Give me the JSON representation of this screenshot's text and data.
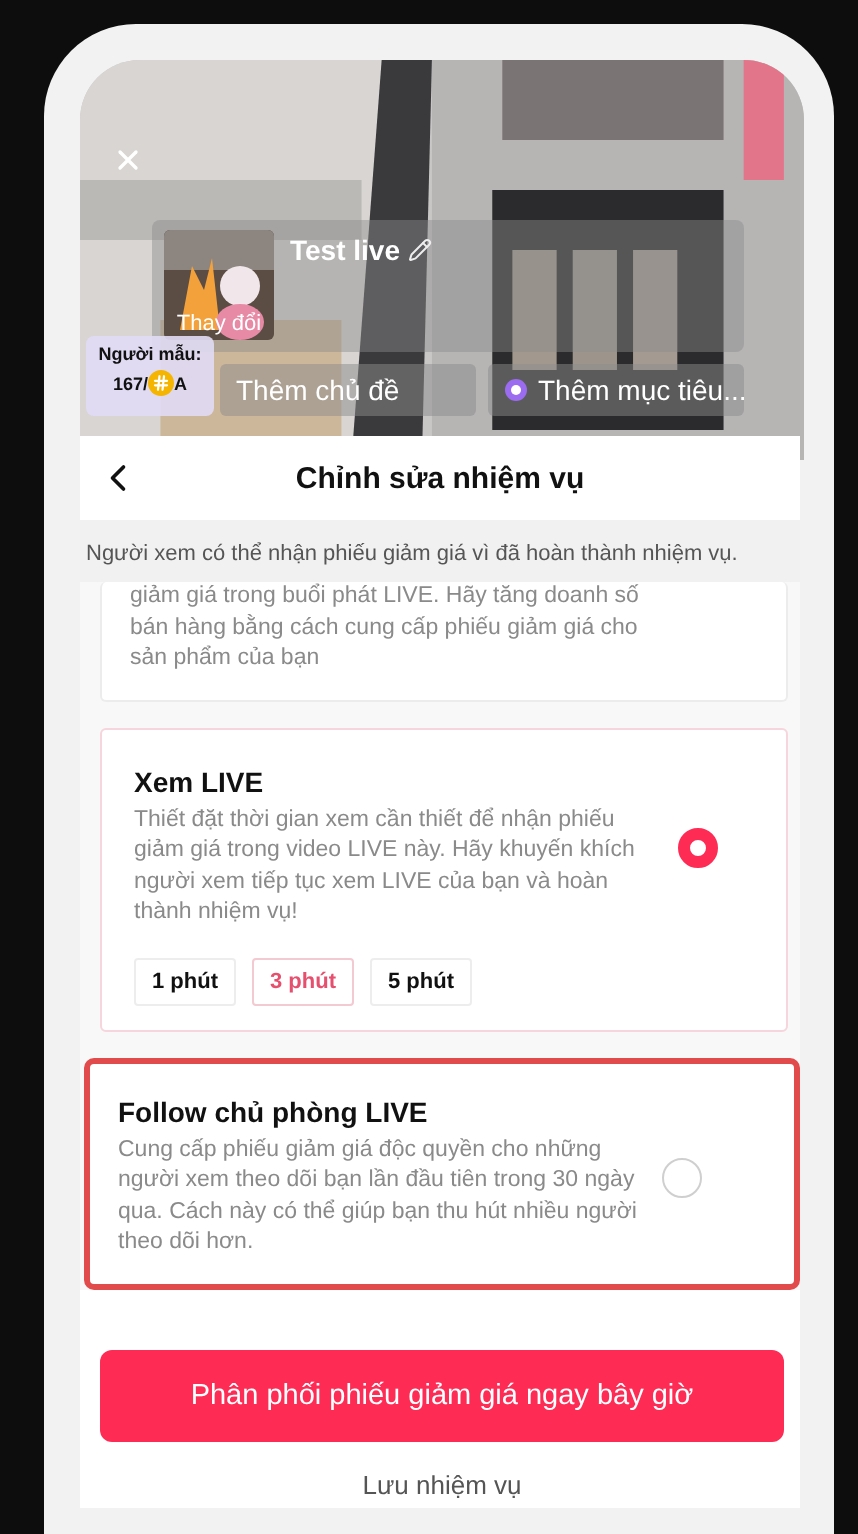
{
  "live_info": {
    "title": "Test live",
    "thumbnail_label": "Thay đổi"
  },
  "model_label": {
    "caption": "Người mẫu:",
    "value_start": "167/",
    "value_end": "A"
  },
  "actions": [
    {
      "kind": "topic",
      "label": "Thêm chủ đề"
    },
    {
      "kind": "goal",
      "label": "Thêm mục tiêu..."
    }
  ],
  "sheet": {
    "title": "Chỉnh sửa nhiệm vụ",
    "description": "Người xem có thể nhận phiếu giảm giá vì đã hoàn thành nhiệm vụ."
  },
  "tasks": [
    {
      "kind": "cut",
      "selected": false,
      "highlighted": false,
      "description": "giảm giá trong buổi phát LIVE. Hãy tăng doanh số bán hàng bằng cách cung cấp phiếu giảm giá cho sản phẩm của bạn"
    },
    {
      "kind": "full",
      "title": "Xem LIVE",
      "selected": true,
      "highlighted": false,
      "description": "Thiết đặt thời gian xem cần thiết để nhận phiếu giảm giá trong video LIVE này. Hãy khuyến khích người xem tiếp tục xem LIVE của bạn và hoàn thành nhiệm vụ!",
      "options": [
        {
          "label": "1 phút",
          "selected": false
        },
        {
          "label": "3 phút",
          "selected": true
        },
        {
          "label": "5 phút",
          "selected": false
        }
      ]
    },
    {
      "kind": "full",
      "title": "Follow chủ phòng LIVE",
      "selected": false,
      "highlighted": true,
      "description": "Cung cấp phiếu giảm giá độc quyền cho những người xem theo dõi bạn lần đầu tiên trong 30 ngày qua. Cách này có thể giúp bạn thu hút nhiều người theo dõi hơn."
    }
  ],
  "primary_button": "Phân phối phiếu giảm giá ngay bây giờ",
  "secondary_link": "Lưu nhiệm vụ"
}
